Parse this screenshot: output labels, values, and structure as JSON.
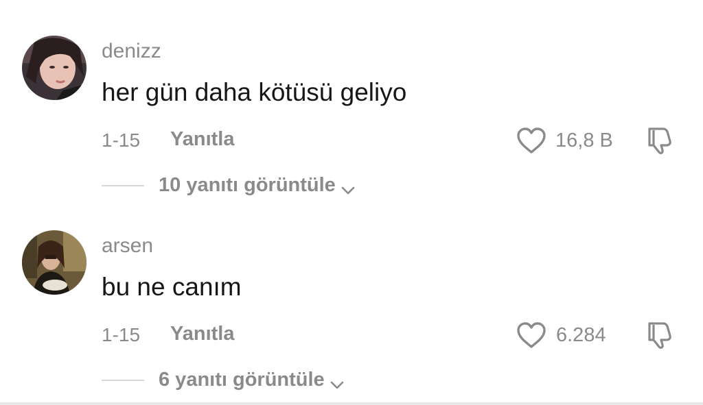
{
  "comments": [
    {
      "username": "denizz",
      "text": "her gün daha kötüsü geliyo",
      "date": "1-15",
      "reply_label": "Yanıtla",
      "likes": "16,8 B",
      "view_replies": "10 yanıtı görüntüle",
      "avatar_icon": "avatar-photo-icon"
    },
    {
      "username": "arsen",
      "text": "bu ne canım",
      "date": "1-15",
      "reply_label": "Yanıtla",
      "likes": "6.284",
      "view_replies": "6 yanıtı görüntüle",
      "avatar_icon": "avatar-photo-icon"
    }
  ],
  "icons": {
    "like": "heart-outline-icon",
    "dislike": "thumbs-down-icon",
    "expand": "chevron-down-icon"
  },
  "colors": {
    "secondary_text": "#8a8a8a",
    "primary_text": "#161616",
    "divider": "#d6d6d6"
  }
}
